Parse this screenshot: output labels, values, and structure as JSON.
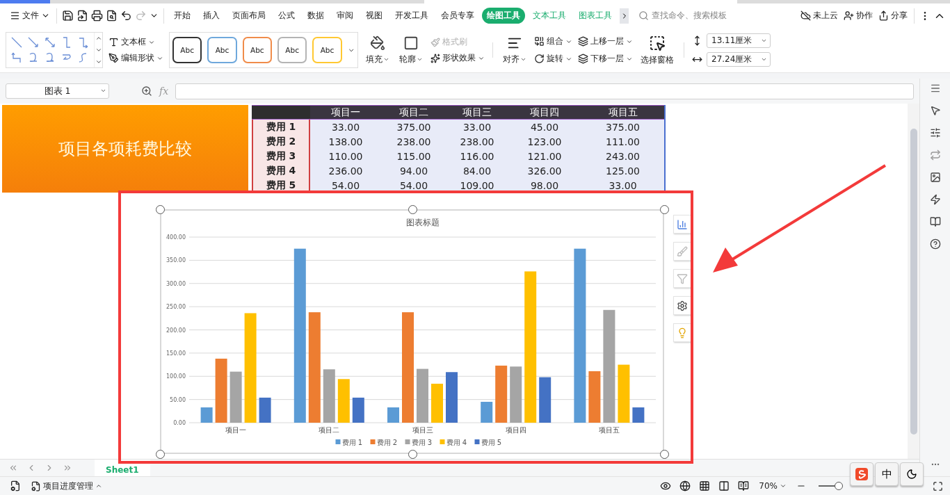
{
  "menu": {
    "file_label": "文件",
    "tabs": [
      {
        "label": "开始",
        "kind": "normal",
        "selected": false
      },
      {
        "label": "插入",
        "kind": "normal",
        "selected": false
      },
      {
        "label": "页面布局",
        "kind": "normal",
        "selected": false
      },
      {
        "label": "公式",
        "kind": "normal",
        "selected": false
      },
      {
        "label": "数据",
        "kind": "normal",
        "selected": false
      },
      {
        "label": "审阅",
        "kind": "normal",
        "selected": false
      },
      {
        "label": "视图",
        "kind": "normal",
        "selected": false
      },
      {
        "label": "开发工具",
        "kind": "normal",
        "selected": false
      },
      {
        "label": "会员专享",
        "kind": "normal",
        "selected": false
      },
      {
        "label": "绘图工具",
        "kind": "context",
        "selected": true
      },
      {
        "label": "文本工具",
        "kind": "context",
        "selected": false
      },
      {
        "label": "图表工具",
        "kind": "context",
        "selected": false
      }
    ],
    "search": {
      "placeholder": "查找命令、搜索模板"
    },
    "actions": [
      "未上云",
      "协作",
      "分享"
    ]
  },
  "ribbon": {
    "style_presets": [
      {
        "label": "Abc",
        "color": "#333333"
      },
      {
        "label": "Abc",
        "color": "#6fa8dc"
      },
      {
        "label": "Abc",
        "color": "#f08c4a"
      },
      {
        "label": "Abc",
        "color": "#b4b4b4"
      },
      {
        "label": "Abc",
        "color": "#ffc832"
      }
    ],
    "text_tools": [
      "文本框",
      "编辑形状"
    ],
    "fill": "填充",
    "outline": "轮廓",
    "format_painter": {
      "label": "格式刷",
      "disabled": true
    },
    "shape_effects": "形状效果",
    "align": "对齐",
    "arrange": [
      "组合",
      "上移一层",
      "旋转",
      "下移一层"
    ],
    "selection_pane": "选择窗格",
    "height": "13.11厘米",
    "width": "27.24厘米"
  },
  "formula_bar": {
    "name_box": "图表 1",
    "fx": "fx"
  },
  "banner": {
    "title": "项目各项耗费比较"
  },
  "table": {
    "columns": [
      "项目一",
      "项目二",
      "项目三",
      "项目四",
      "项目五"
    ],
    "rows": [
      {
        "label": "费用 1",
        "cells": [
          "33.00",
          "375.00",
          "33.00",
          "45.00",
          "375.00"
        ]
      },
      {
        "label": "费用 2",
        "cells": [
          "138.00",
          "238.00",
          "238.00",
          "123.00",
          "111.00"
        ]
      },
      {
        "label": "费用 3",
        "cells": [
          "110.00",
          "115.00",
          "116.00",
          "121.00",
          "243.00"
        ]
      },
      {
        "label": "费用 4",
        "cells": [
          "236.00",
          "94.00",
          "84.00",
          "326.00",
          "125.00"
        ]
      },
      {
        "label": "费用 5",
        "cells": [
          "54.00",
          "54.00",
          "109.00",
          "98.00",
          "33.00"
        ]
      }
    ]
  },
  "chart": {
    "chart_data": {
      "type": "bar",
      "title": "图表标题",
      "grid": true,
      "legend": true,
      "categories": [
        "项目一",
        "项目二",
        "项目三",
        "项目四",
        "项目五"
      ],
      "ylim": [
        0,
        400
      ],
      "yticks": [
        {
          "value": 0,
          "label": "0.00"
        },
        {
          "value": 50,
          "label": "50.00"
        },
        {
          "value": 100,
          "label": "100.00"
        },
        {
          "value": 150,
          "label": "150.00"
        },
        {
          "value": 200,
          "label": "200.00"
        },
        {
          "value": 250,
          "label": "250.00"
        },
        {
          "value": 300,
          "label": "300.00"
        },
        {
          "value": 350,
          "label": "350.00"
        },
        {
          "value": 400,
          "label": "400.00"
        }
      ],
      "series": [
        {
          "name": "费用 1",
          "color": "#5b9bd5",
          "values": [
            33,
            375,
            33,
            45,
            375
          ]
        },
        {
          "name": "费用 2",
          "color": "#ed7d31",
          "values": [
            138,
            238,
            238,
            123,
            111
          ]
        },
        {
          "name": "费用 3",
          "color": "#a5a5a5",
          "values": [
            110,
            115,
            116,
            121,
            243
          ]
        },
        {
          "name": "费用 4",
          "color": "#ffc000",
          "values": [
            236,
            94,
            84,
            326,
            125
          ]
        },
        {
          "name": "费用 5",
          "color": "#4472c4",
          "values": [
            54,
            54,
            109,
            98,
            33
          ]
        }
      ]
    }
  },
  "sheet_tabs": [
    {
      "label": "Sheet1",
      "selected": true
    }
  ],
  "status_bar": {
    "workbook": "项目进度管理",
    "zoom": "70%",
    "zoom_slider": {
      "level": 0.85
    }
  },
  "ime": {
    "mode": "中"
  }
}
